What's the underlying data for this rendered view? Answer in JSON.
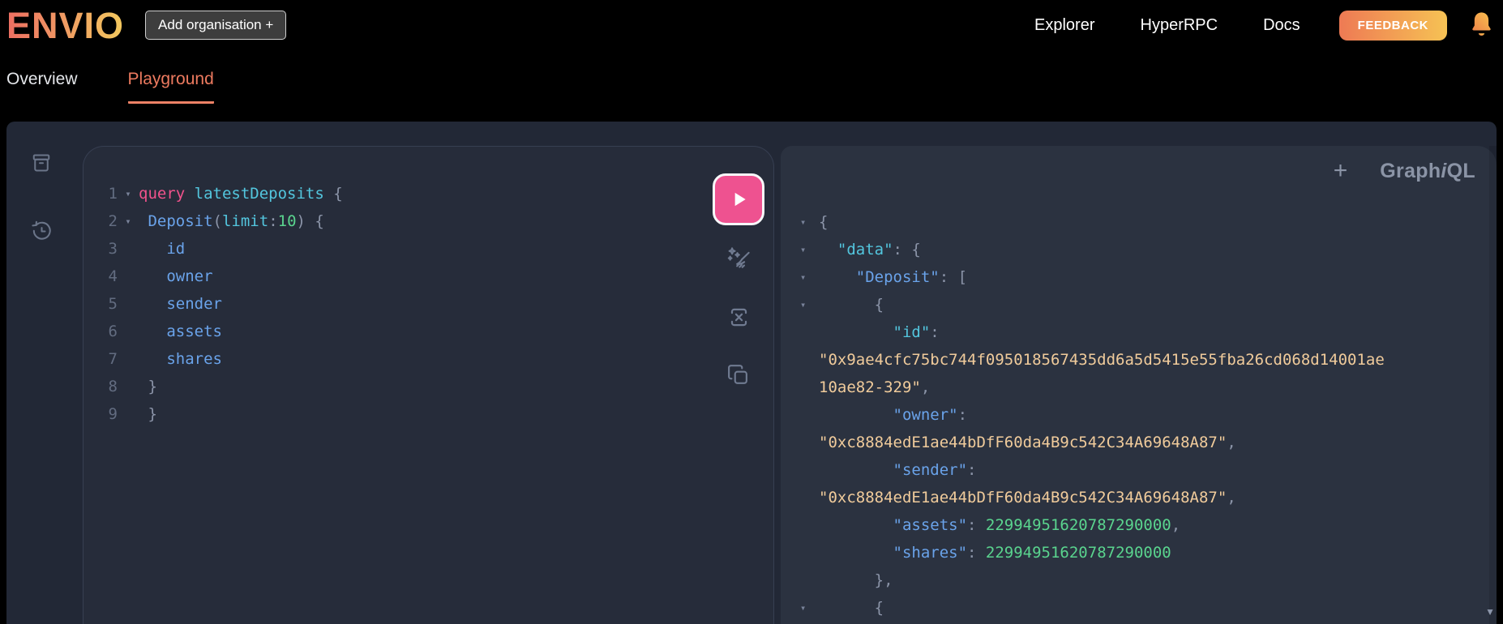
{
  "header": {
    "logo_text": "ENVIO",
    "add_org_button": "Add organisation +",
    "nav": [
      {
        "label": "Explorer"
      },
      {
        "label": "HyperRPC"
      },
      {
        "label": "Docs"
      }
    ],
    "feedback_button": "FEEDBACK",
    "bell_icon": "notification-bell-icon"
  },
  "tabs": [
    {
      "label": "Overview",
      "active": false
    },
    {
      "label": "Playground",
      "active": true
    }
  ],
  "colors": {
    "accent_tab_orange": "#ed7a5f",
    "logo_gradient_start": "#ed6e62",
    "logo_gradient_end": "#f3c95e",
    "feedback_gradient_start": "#ee7a54",
    "feedback_gradient_end": "#f6c254",
    "play_button_pink": "#ee5290",
    "code_keyword_pink": "#f1538c",
    "code_cyan": "#53c6de",
    "code_blue": "#6aa3ea",
    "code_green": "#5ad48e",
    "code_string_tan": "#f0cb9b",
    "code_punctuation": "#8b94a8",
    "panel_background": "#262c3a",
    "response_background": "#2b3240",
    "container_background": "#222836"
  },
  "playground": {
    "sidebar_icons": [
      {
        "name": "docs-explorer-icon"
      },
      {
        "name": "history-icon"
      }
    ],
    "toolbar_icons": [
      {
        "name": "execute-play-icon"
      },
      {
        "name": "prettify-icon"
      },
      {
        "name": "merge-icon"
      },
      {
        "name": "copy-icon"
      }
    ],
    "response_header": {
      "add_tab": "+",
      "brand_graph": "Graph",
      "brand_i": "i",
      "brand_ql": "QL"
    },
    "query_editor": {
      "lines": [
        {
          "num": "1",
          "fold": true,
          "tokens": [
            {
              "t": "query",
              "c": "pink"
            },
            {
              "t": " ",
              "c": "punc"
            },
            {
              "t": "latestDeposits",
              "c": "cyan"
            },
            {
              "t": " {",
              "c": "punc"
            }
          ]
        },
        {
          "num": "2",
          "fold": true,
          "tokens": [
            {
              "t": " ",
              "c": "punc"
            },
            {
              "t": "Deposit",
              "c": "blue"
            },
            {
              "t": "(",
              "c": "punc"
            },
            {
              "t": "limit",
              "c": "cyan"
            },
            {
              "t": ":",
              "c": "punc"
            },
            {
              "t": "10",
              "c": "green"
            },
            {
              "t": ")",
              "c": "punc"
            },
            {
              "t": " {",
              "c": "punc"
            }
          ]
        },
        {
          "num": "3",
          "fold": false,
          "tokens": [
            {
              "t": "   ",
              "c": "punc"
            },
            {
              "t": "id",
              "c": "blue"
            }
          ]
        },
        {
          "num": "4",
          "fold": false,
          "tokens": [
            {
              "t": "   ",
              "c": "punc"
            },
            {
              "t": "owner",
              "c": "blue"
            }
          ]
        },
        {
          "num": "5",
          "fold": false,
          "tokens": [
            {
              "t": "   ",
              "c": "punc"
            },
            {
              "t": "sender",
              "c": "blue"
            }
          ]
        },
        {
          "num": "6",
          "fold": false,
          "tokens": [
            {
              "t": "   ",
              "c": "punc"
            },
            {
              "t": "assets",
              "c": "blue"
            }
          ]
        },
        {
          "num": "7",
          "fold": false,
          "tokens": [
            {
              "t": "   ",
              "c": "punc"
            },
            {
              "t": "shares",
              "c": "blue"
            }
          ]
        },
        {
          "num": "8",
          "fold": false,
          "tokens": [
            {
              "t": " }",
              "c": "punc"
            }
          ]
        },
        {
          "num": "9",
          "fold": false,
          "tokens": [
            {
              "t": " }",
              "c": "punc"
            }
          ]
        }
      ]
    },
    "response_viewer": {
      "rows": [
        {
          "fold": true,
          "tokens": [
            {
              "t": "{",
              "c": "punc"
            }
          ]
        },
        {
          "fold": true,
          "tokens": [
            {
              "t": "  ",
              "c": "punc"
            },
            {
              "t": "\"data\"",
              "c": "cyan"
            },
            {
              "t": ": {",
              "c": "punc"
            }
          ]
        },
        {
          "fold": true,
          "tokens": [
            {
              "t": "    ",
              "c": "punc"
            },
            {
              "t": "\"Deposit\"",
              "c": "blue"
            },
            {
              "t": ": [",
              "c": "punc"
            }
          ]
        },
        {
          "fold": true,
          "tokens": [
            {
              "t": "      {",
              "c": "punc"
            }
          ]
        },
        {
          "fold": false,
          "tokens": [
            {
              "t": "        ",
              "c": "punc"
            },
            {
              "t": "\"id\"",
              "c": "cyan"
            },
            {
              "t": ":",
              "c": "punc"
            }
          ]
        },
        {
          "fold": false,
          "tokens": [
            {
              "t": "\"0x9ae4cfc75bc744f095018567435dd6a5d5415e55fba26cd068d14001ae",
              "c": "str"
            }
          ]
        },
        {
          "fold": false,
          "tokens": [
            {
              "t": "10ae82-329\"",
              "c": "str"
            },
            {
              "t": ",",
              "c": "punc"
            }
          ]
        },
        {
          "fold": false,
          "tokens": [
            {
              "t": "        ",
              "c": "punc"
            },
            {
              "t": "\"owner\"",
              "c": "blue"
            },
            {
              "t": ":",
              "c": "punc"
            }
          ]
        },
        {
          "fold": false,
          "tokens": [
            {
              "t": "\"0xc8884edE1ae44bDfF60da4B9c542C34A69648A87\"",
              "c": "str"
            },
            {
              "t": ",",
              "c": "punc"
            }
          ]
        },
        {
          "fold": false,
          "tokens": [
            {
              "t": "        ",
              "c": "punc"
            },
            {
              "t": "\"sender\"",
              "c": "blue"
            },
            {
              "t": ":",
              "c": "punc"
            }
          ]
        },
        {
          "fold": false,
          "tokens": [
            {
              "t": "\"0xc8884edE1ae44bDfF60da4B9c542C34A69648A87\"",
              "c": "str"
            },
            {
              "t": ",",
              "c": "punc"
            }
          ]
        },
        {
          "fold": false,
          "tokens": [
            {
              "t": "        ",
              "c": "punc"
            },
            {
              "t": "\"assets\"",
              "c": "blue"
            },
            {
              "t": ": ",
              "c": "punc"
            },
            {
              "t": "22994951620787290000",
              "c": "green"
            },
            {
              "t": ",",
              "c": "punc"
            }
          ]
        },
        {
          "fold": false,
          "tokens": [
            {
              "t": "        ",
              "c": "punc"
            },
            {
              "t": "\"shares\"",
              "c": "blue"
            },
            {
              "t": ": ",
              "c": "punc"
            },
            {
              "t": "22994951620787290000",
              "c": "green"
            }
          ]
        },
        {
          "fold": false,
          "tokens": [
            {
              "t": "      },",
              "c": "punc"
            }
          ]
        },
        {
          "fold": true,
          "tokens": [
            {
              "t": "      {",
              "c": "punc"
            }
          ]
        }
      ]
    },
    "result_record": {
      "id": "0x9ae4cfc75bc744f095018567435dd6a5d5415e55fba26cd068d14001ae10ae82-329",
      "owner": "0xc8884edE1ae44bDfF60da4B9c542C34A69648A87",
      "sender": "0xc8884edE1ae44bDfF60da4B9c542C34A69648A87",
      "assets": "22994951620787290000",
      "shares": "22994951620787290000"
    }
  }
}
